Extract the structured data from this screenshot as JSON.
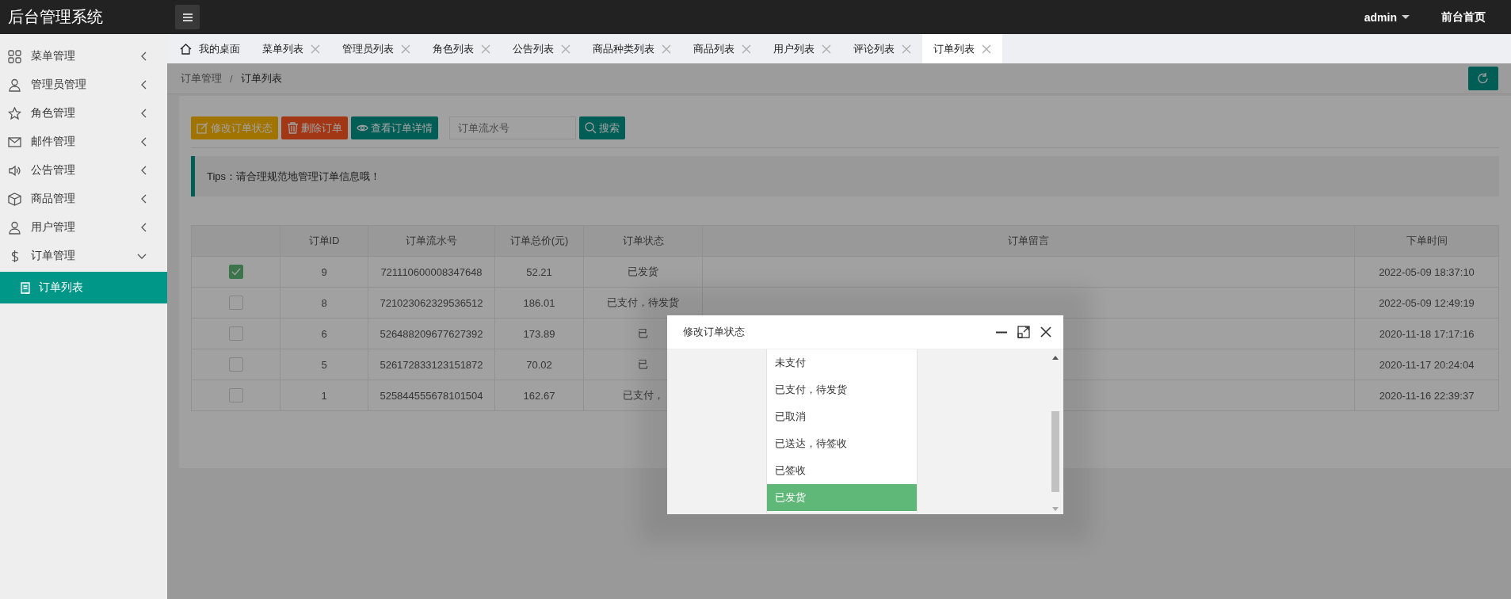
{
  "app_title": "后台管理系统",
  "header": {
    "user": "admin",
    "home_link": "前台首页"
  },
  "sidebar": {
    "items": [
      {
        "label": "菜单管理",
        "expanded": false
      },
      {
        "label": "管理员管理",
        "expanded": false
      },
      {
        "label": "角色管理",
        "expanded": false
      },
      {
        "label": "邮件管理",
        "expanded": false
      },
      {
        "label": "公告管理",
        "expanded": false
      },
      {
        "label": "商品管理",
        "expanded": false
      },
      {
        "label": "用户管理",
        "expanded": false
      },
      {
        "label": "订单管理",
        "expanded": true,
        "children": [
          {
            "label": "订单列表",
            "selected": true
          }
        ]
      }
    ]
  },
  "tabs": [
    {
      "label": "我的桌面",
      "kind": "home",
      "selected": false
    },
    {
      "label": "菜单列表",
      "kind": "page",
      "selected": false
    },
    {
      "label": "管理员列表",
      "kind": "page",
      "selected": false
    },
    {
      "label": "角色列表",
      "kind": "page",
      "selected": false
    },
    {
      "label": "公告列表",
      "kind": "page",
      "selected": false
    },
    {
      "label": "商品种类列表",
      "kind": "page",
      "selected": false
    },
    {
      "label": "商品列表",
      "kind": "page",
      "selected": false
    },
    {
      "label": "用户列表",
      "kind": "page",
      "selected": false
    },
    {
      "label": "评论列表",
      "kind": "page",
      "selected": false
    },
    {
      "label": "订单列表",
      "kind": "page",
      "selected": true
    }
  ],
  "breadcrumb": {
    "items": [
      "订单管理",
      "订单列表"
    ],
    "separator": "/"
  },
  "toolbar": {
    "buttons": [
      {
        "label": "修改订单状态",
        "kind": "edit"
      },
      {
        "label": "删除订单",
        "kind": "delete"
      },
      {
        "label": "查看订单详情",
        "kind": "view"
      }
    ],
    "search": {
      "placeholder": "订单流水号"
    },
    "search_button": "搜索"
  },
  "tips": "Tips：请合理规范地管理订单信息哦！",
  "table": {
    "columns": [
      "订单ID",
      "订单流水号",
      "订单总价(元)",
      "订单状态",
      "订单留言",
      "下单时间"
    ],
    "rows": [
      {
        "checked": true,
        "id": "9",
        "serial": "721110600008347648",
        "total": "52.21",
        "status": "已发货",
        "time": "2022-05-09 18:37:10"
      },
      {
        "checked": false,
        "id": "8",
        "serial": "721023062329536512",
        "total": "186.01",
        "status": "已支付，待发货",
        "time": "2022-05-09 12:49:19"
      },
      {
        "checked": false,
        "id": "6",
        "serial": "526488209677627392",
        "total": "173.89",
        "status": "已",
        "time": "2020-11-18 17:17:16"
      },
      {
        "checked": false,
        "id": "5",
        "serial": "526172833123151872",
        "total": "70.02",
        "status": "已",
        "time": "2020-11-17 20:24:04"
      },
      {
        "checked": false,
        "id": "1",
        "serial": "525844555678101504",
        "total": "162.67",
        "status": "已支付，",
        "time": "2020-11-16 22:39:37"
      }
    ]
  },
  "dialog": {
    "title": "修改订单状态",
    "options": [
      {
        "label": "未支付",
        "selected": false
      },
      {
        "label": "已支付，待发货",
        "selected": false
      },
      {
        "label": "已取消",
        "selected": false
      },
      {
        "label": "已送达，待签收",
        "selected": false
      },
      {
        "label": "已签收",
        "selected": false
      },
      {
        "label": "已发货",
        "selected": true
      }
    ]
  }
}
